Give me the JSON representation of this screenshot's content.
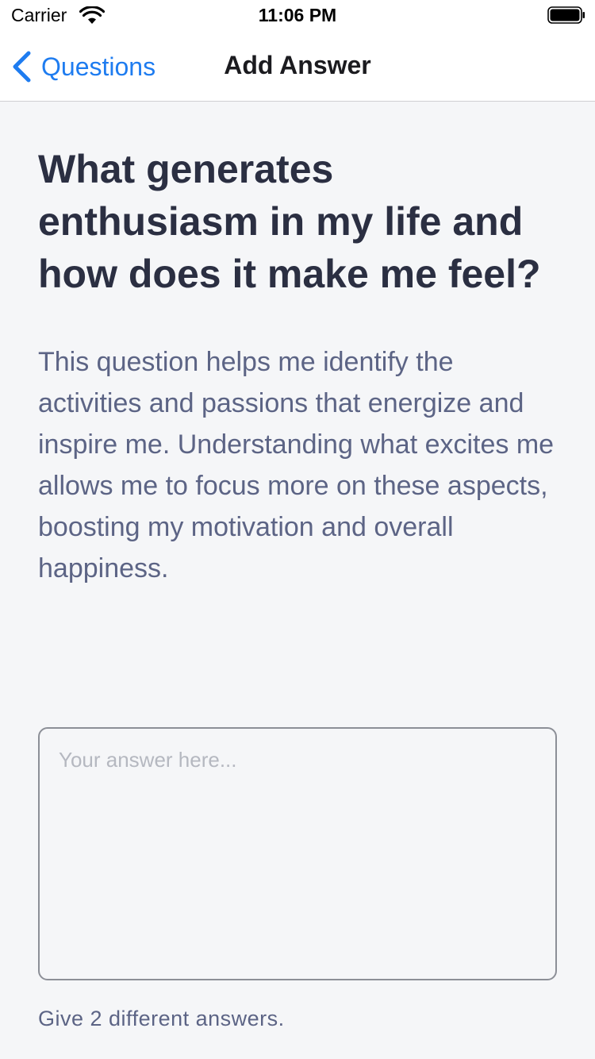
{
  "status_bar": {
    "carrier": "Carrier",
    "time": "11:06 PM"
  },
  "nav": {
    "back_label": "Questions",
    "title": "Add Answer"
  },
  "question": {
    "title": "What generates enthusiasm in my life and how does it make me feel?",
    "description": "This question helps me identify the activities and passions that energize and inspire me. Understanding what excites me allows me to focus more on these aspects, boosting my motivation and overall happiness."
  },
  "answer": {
    "value": "",
    "placeholder": "Your answer here..."
  },
  "hint": "Give 2 different answers.",
  "colors": {
    "accent": "#1e7cf0",
    "title": "#2b2f42",
    "body": "#5c6485",
    "background": "#f5f6f8"
  }
}
